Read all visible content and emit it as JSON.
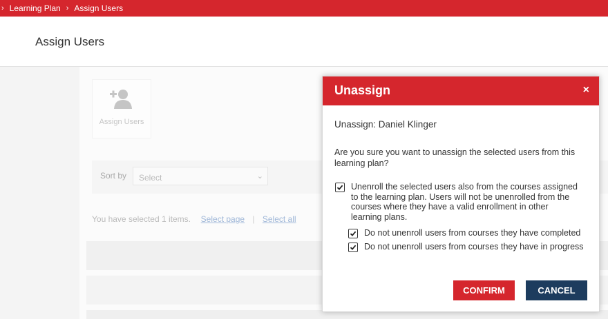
{
  "breadcrumb": {
    "items": [
      "Learning Plan",
      "Assign Users"
    ]
  },
  "header": {
    "title": "Assign Users"
  },
  "background": {
    "assign_tile_label": "Assign Users",
    "sort_label": "Sort by",
    "sort_value": "Select",
    "selection_text": "You have selected 1 items.",
    "select_page": "Select page",
    "select_all": "Select all"
  },
  "modal": {
    "title": "Unassign",
    "close": "×",
    "unassign_line": "Unassign: Daniel Klinger",
    "question": "Are you sure you want to unassign the selected users from this learning plan?",
    "options": [
      {
        "label": "Unenroll the selected users also from the courses assigned to the learning plan. Users will not be unenrolled from the courses where they have a valid enrollment in other learning plans.",
        "checked": true
      },
      {
        "label": "Do not unenroll users from courses they have completed",
        "checked": true
      },
      {
        "label": "Do not unenroll users from courses they have in progress",
        "checked": true
      }
    ],
    "confirm": "CONFIRM",
    "cancel": "CANCEL"
  },
  "colors": {
    "brand_red": "#d5262d",
    "navy": "#1d3c5e"
  }
}
